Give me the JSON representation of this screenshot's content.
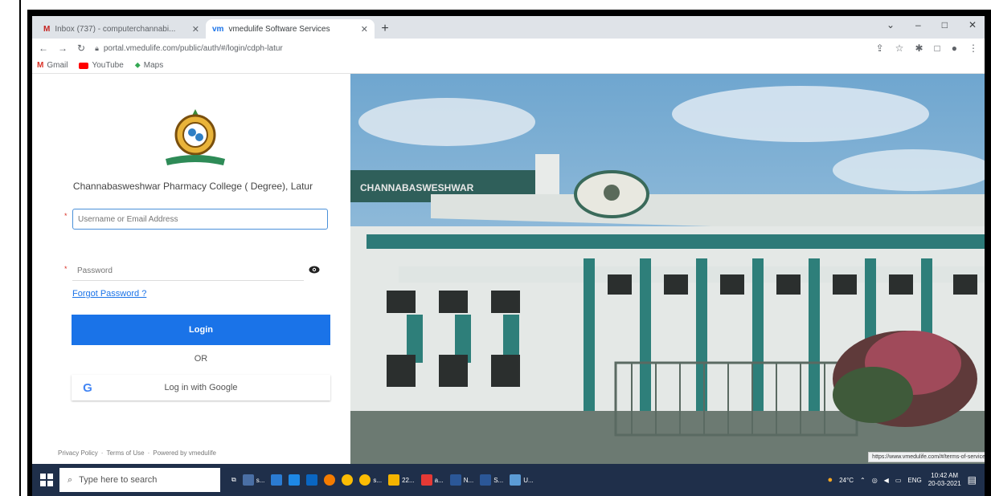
{
  "browser": {
    "tabs": [
      {
        "label": "Inbox (737) - computerchannabi...",
        "icon": "gmail-icon",
        "active": false
      },
      {
        "label": "vmedulife Software Services",
        "icon": "vmedulife-icon",
        "active": true
      }
    ],
    "new_tab": "+",
    "window_controls": {
      "minimize": "–",
      "maximize": "□",
      "close": "✕"
    },
    "url": "portal.vmedulife.com/public/auth/#/login/cdph-latur",
    "bookmarks": [
      {
        "label": "Gmail",
        "icon": "gmail-icon"
      },
      {
        "label": "YouTube",
        "icon": "youtube-icon"
      },
      {
        "label": "Maps",
        "icon": "maps-icon"
      }
    ]
  },
  "login": {
    "college_name": "Channabasweshwar Pharmacy College ( Degree), Latur",
    "username_placeholder": "Username or Email Address",
    "password_placeholder": "Password",
    "required_mark": "*",
    "forgot_password": "Forgot Password ?",
    "login_button": "Login",
    "or_text": "OR",
    "google_letter": "G",
    "google_button": "Log in with Google",
    "footer": {
      "privacy": "Privacy Policy",
      "terms": "Terms of Use",
      "powered": "Powered by vmedulife"
    }
  },
  "hero": {
    "status_url": "https://www.vmedulife.com/#/terms-of-service",
    "building_sign": "CHANNABASWESHWAR"
  },
  "taskbar": {
    "search_placeholder": "Type here to search",
    "apps": [
      {
        "label": "s...",
        "color": "#4a6fa5"
      },
      {
        "label": "",
        "color": "#2b7cd3"
      },
      {
        "label": "",
        "color": "#1e88e5"
      },
      {
        "label": "",
        "color": "#0a66c2"
      },
      {
        "label": "",
        "color": "#f57c00"
      },
      {
        "label": "",
        "color": "#fbbc04"
      },
      {
        "label": "s...",
        "color": "#fbbc04"
      },
      {
        "label": "22...",
        "color": "#f4b400"
      },
      {
        "label": "a...",
        "color": "#e53935"
      },
      {
        "label": "N...",
        "color": "#2b5797"
      },
      {
        "label": "S...",
        "color": "#2b5797"
      },
      {
        "label": "U...",
        "color": "#5b9bd5"
      }
    ],
    "weather": "24°C",
    "language": "ENG",
    "time": "10:42 AM",
    "date": "20-03-2021"
  }
}
